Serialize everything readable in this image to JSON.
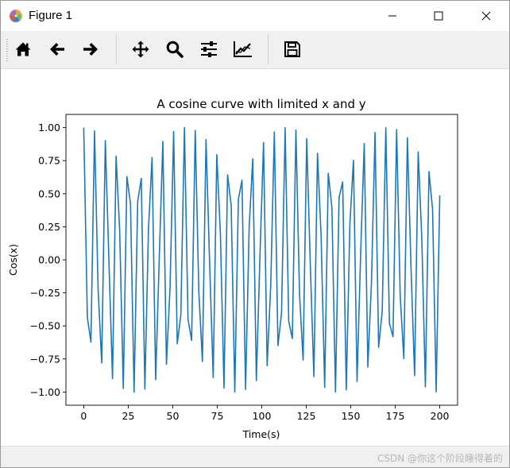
{
  "window": {
    "title": "Figure 1",
    "controls": {
      "minimize_icon": "minimize-icon",
      "maximize_icon": "maximize-icon",
      "close_icon": "close-icon"
    }
  },
  "toolbar": {
    "tools": [
      {
        "name": "home",
        "icon": "home-icon"
      },
      {
        "name": "back",
        "icon": "arrow-left-icon"
      },
      {
        "name": "forward",
        "icon": "arrow-right-icon"
      },
      {
        "name": "pan",
        "icon": "move-icon"
      },
      {
        "name": "zoom",
        "icon": "magnifier-icon"
      },
      {
        "name": "configure-subplots",
        "icon": "sliders-icon"
      },
      {
        "name": "edit-axis",
        "icon": "line-chart-icon"
      },
      {
        "name": "save",
        "icon": "floppy-disk-icon"
      }
    ]
  },
  "status": {
    "watermark": "CSDN @你这个阶段睡得着的"
  },
  "colors": {
    "line": "#1f77b4",
    "toolbar_bg": "#f0f0f0"
  },
  "chart_data": {
    "type": "line",
    "title": "A cosine curve with limited x and y",
    "xlabel": "Time(s)",
    "ylabel": "Cos(x)",
    "xlim": [
      -10,
      210
    ],
    "ylim": [
      -1.1,
      1.1
    ],
    "xticks": [
      0,
      25,
      50,
      75,
      100,
      125,
      150,
      175,
      200
    ],
    "xtick_labels": [
      "0",
      "25",
      "50",
      "75",
      "100",
      "125",
      "150",
      "175",
      "200"
    ],
    "yticks": [
      1.0,
      0.75,
      0.5,
      0.25,
      0.0,
      -0.25,
      -0.5,
      -0.75,
      -1.0
    ],
    "ytick_labels": [
      "1.00",
      "0.75",
      "0.50",
      "0.25",
      "0.00",
      "−0.25",
      "−0.50",
      "−0.75",
      "−1.00"
    ],
    "grid": false,
    "series": [
      {
        "function": "cos",
        "x_start": 0,
        "x_end": 200,
        "num_points": 100,
        "color": "#1f77b4"
      }
    ]
  }
}
